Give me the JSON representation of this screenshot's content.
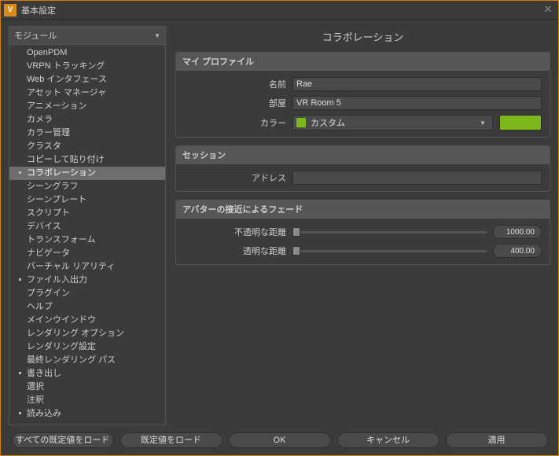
{
  "window": {
    "title": "基本設定",
    "app_icon_letter": "V"
  },
  "sidebar": {
    "header": "モジュール",
    "items": [
      {
        "label": "OpenPDM",
        "dot": false
      },
      {
        "label": "VRPN トラッキング",
        "dot": false
      },
      {
        "label": "Web インタフェース",
        "dot": false
      },
      {
        "label": "アセット マネージャ",
        "dot": false
      },
      {
        "label": "アニメーション",
        "dot": false
      },
      {
        "label": "カメラ",
        "dot": false
      },
      {
        "label": "カラー管理",
        "dot": false
      },
      {
        "label": "クラスタ",
        "dot": false
      },
      {
        "label": "コピーして貼り付け",
        "dot": false
      },
      {
        "label": "コラボレーション",
        "dot": true,
        "selected": true
      },
      {
        "label": "シーングラフ",
        "dot": false
      },
      {
        "label": "シーンプレート",
        "dot": false
      },
      {
        "label": "スクリプト",
        "dot": false
      },
      {
        "label": "デバイス",
        "dot": false
      },
      {
        "label": "トランスフォーム",
        "dot": false
      },
      {
        "label": "ナビゲータ",
        "dot": false
      },
      {
        "label": "バーチャル リアリティ",
        "dot": false
      },
      {
        "label": "ファイル入出力",
        "dot": true
      },
      {
        "label": "プラグイン",
        "dot": false
      },
      {
        "label": "ヘルプ",
        "dot": false
      },
      {
        "label": "メインウインドウ",
        "dot": false
      },
      {
        "label": "レンダリング オプション",
        "dot": false
      },
      {
        "label": "レンダリング設定",
        "dot": false
      },
      {
        "label": "最終レンダリング パス",
        "dot": false
      },
      {
        "label": "書き出し",
        "dot": true
      },
      {
        "label": "選択",
        "dot": false
      },
      {
        "label": "注釈",
        "dot": false
      },
      {
        "label": "読み込み",
        "dot": true
      }
    ]
  },
  "page": {
    "title": "コラボレーション",
    "profile": {
      "heading": "マイ プロファイル",
      "name_label": "名前",
      "name_value": "Rae",
      "room_label": "部屋",
      "room_value": "VR Room 5",
      "color_label": "カラー",
      "color_name": "カスタム",
      "color_hex": "#7db81b"
    },
    "session": {
      "heading": "セッション",
      "address_label": "アドレス",
      "address_value": ""
    },
    "fade": {
      "heading": "アバターの接近によるフェード",
      "opaque_label": "不透明な距離",
      "opaque_value": "1000.00",
      "transparent_label": "透明な距離",
      "transparent_value": "400.00"
    }
  },
  "buttons": {
    "load_all_defaults": "すべての既定値をロード",
    "load_defaults": "既定値をロード",
    "ok": "OK",
    "cancel": "キャンセル",
    "apply": "適用"
  }
}
